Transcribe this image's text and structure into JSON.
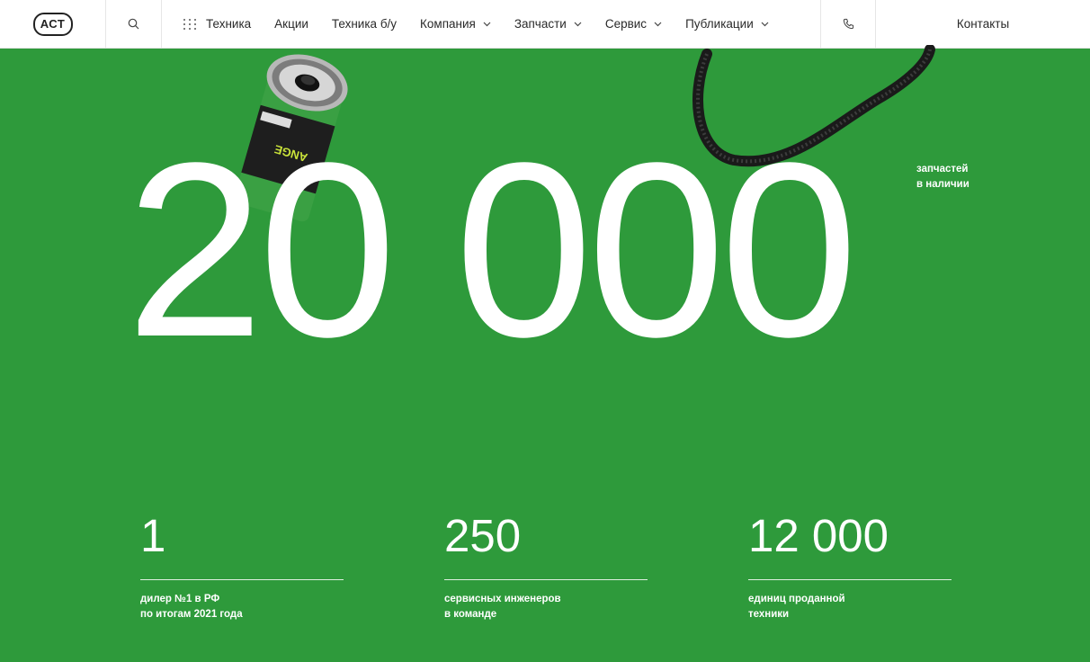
{
  "header": {
    "logo_text": "АСТ",
    "nav": [
      {
        "label": "Техника",
        "icon": "grid-dots-icon"
      },
      {
        "label": "Акции"
      },
      {
        "label": "Техника б/у"
      },
      {
        "label": "Компания",
        "dropdown": true
      },
      {
        "label": "Запчасти",
        "dropdown": true
      },
      {
        "label": "Сервис",
        "dropdown": true
      },
      {
        "label": "Публикации",
        "dropdown": true
      }
    ],
    "contacts_label": "Контакты"
  },
  "hero": {
    "number": "20 000",
    "caption_line1": "запчастей",
    "caption_line2": "в наличии"
  },
  "stats": [
    {
      "value": "1",
      "line1": "дилер №1 в РФ",
      "line2": "по итогам 2021 года"
    },
    {
      "value": "250",
      "line1": "сервисных инженеров",
      "line2": "в команде"
    },
    {
      "value": "12 000",
      "line1": "единиц проданной",
      "line2": "техники"
    }
  ],
  "colors": {
    "background": "#2e9a3b",
    "header": "#ffffff",
    "text": "#ffffff"
  }
}
